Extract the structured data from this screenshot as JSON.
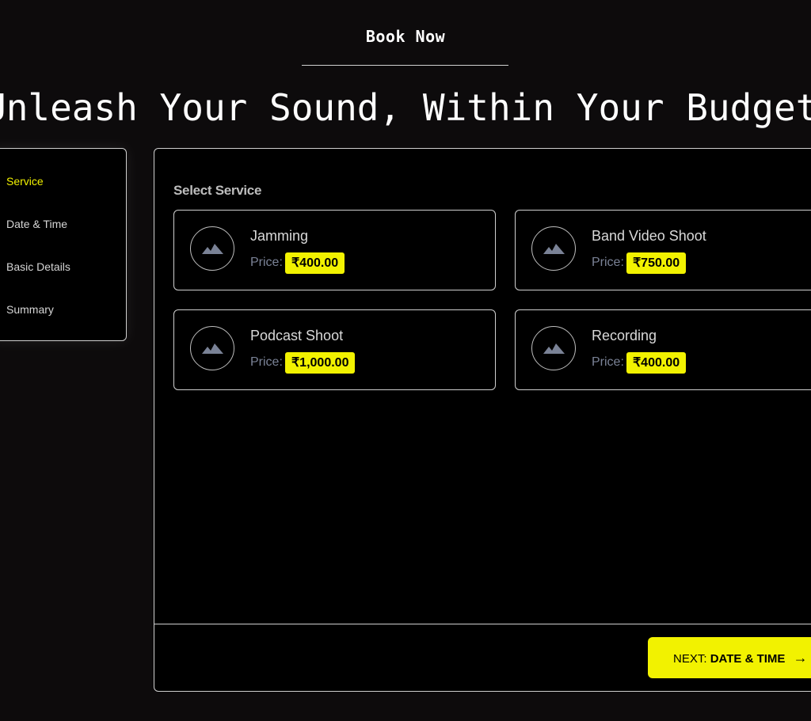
{
  "header": {
    "book_now": "Book Now",
    "headline": "Unleash Your Sound, Within Your Budget"
  },
  "steps": [
    {
      "label": "Service",
      "active": true
    },
    {
      "label": "Date & Time",
      "active": false
    },
    {
      "label": "Basic Details",
      "active": false
    },
    {
      "label": "Summary",
      "active": false
    }
  ],
  "panel": {
    "title": "Select Service",
    "price_label": "Price:",
    "services": [
      {
        "name": "Jamming",
        "price": "₹400.00"
      },
      {
        "name": "Band Video Shoot",
        "price": "₹750.00"
      },
      {
        "name": "Podcast Shoot",
        "price": "₹1,000.00"
      },
      {
        "name": "Recording",
        "price": "₹400.00"
      }
    ]
  },
  "footer": {
    "next_prefix": "NEXT:",
    "next_step": "DATE & TIME",
    "next_arrow": "→"
  },
  "colors": {
    "accent": "#f2f200",
    "background": "#0d0b0c",
    "panel": "#000000"
  },
  "icons": {
    "service_icon": "image-placeholder-icon",
    "next_icon": "arrow-right-icon"
  }
}
